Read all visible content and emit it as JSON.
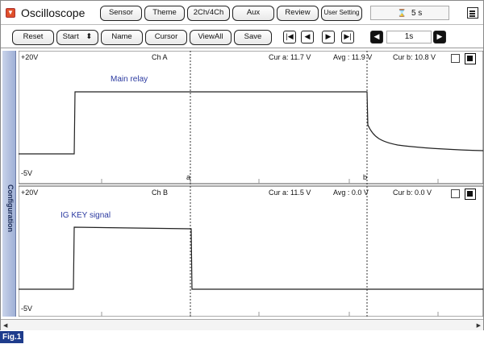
{
  "app": {
    "title": "Oscilloscope",
    "icon": "dropdown-icon"
  },
  "toolbar1": {
    "buttons": [
      "Sensor",
      "Theme",
      "2Ch/4Ch",
      "Aux",
      "Review",
      "User Setting"
    ],
    "time_display": "5 s",
    "time_icon": "hourglass-icon"
  },
  "toolbar2": {
    "buttons": [
      "Reset",
      "Start",
      "Name",
      "Cursor",
      "ViewAll",
      "Save"
    ],
    "start_arrows": "⬍",
    "nav": [
      "first-icon",
      "prev-icon",
      "next-icon",
      "last-icon"
    ],
    "scale_value": "1s"
  },
  "sidebar": {
    "label": "Configuration"
  },
  "channels": [
    {
      "name": "Ch A",
      "top_label": "+20V",
      "bottom_label": "-5V",
      "cur_a": "Cur a: 11.7 V",
      "avg": "Avg : 11.9 V",
      "cur_b": "Cur b: 10.8 V",
      "signal_label": "Main relay",
      "cursor_a": "a",
      "cursor_b": "b"
    },
    {
      "name": "Ch B",
      "top_label": "+20V",
      "bottom_label": "-5V",
      "cur_a": "Cur a: 11.5 V",
      "avg": "Avg : 0.0 V",
      "cur_b": "Cur b: 0.0 V",
      "signal_label": "IG KEY signal"
    }
  ],
  "figure_label": "Fig.1"
}
